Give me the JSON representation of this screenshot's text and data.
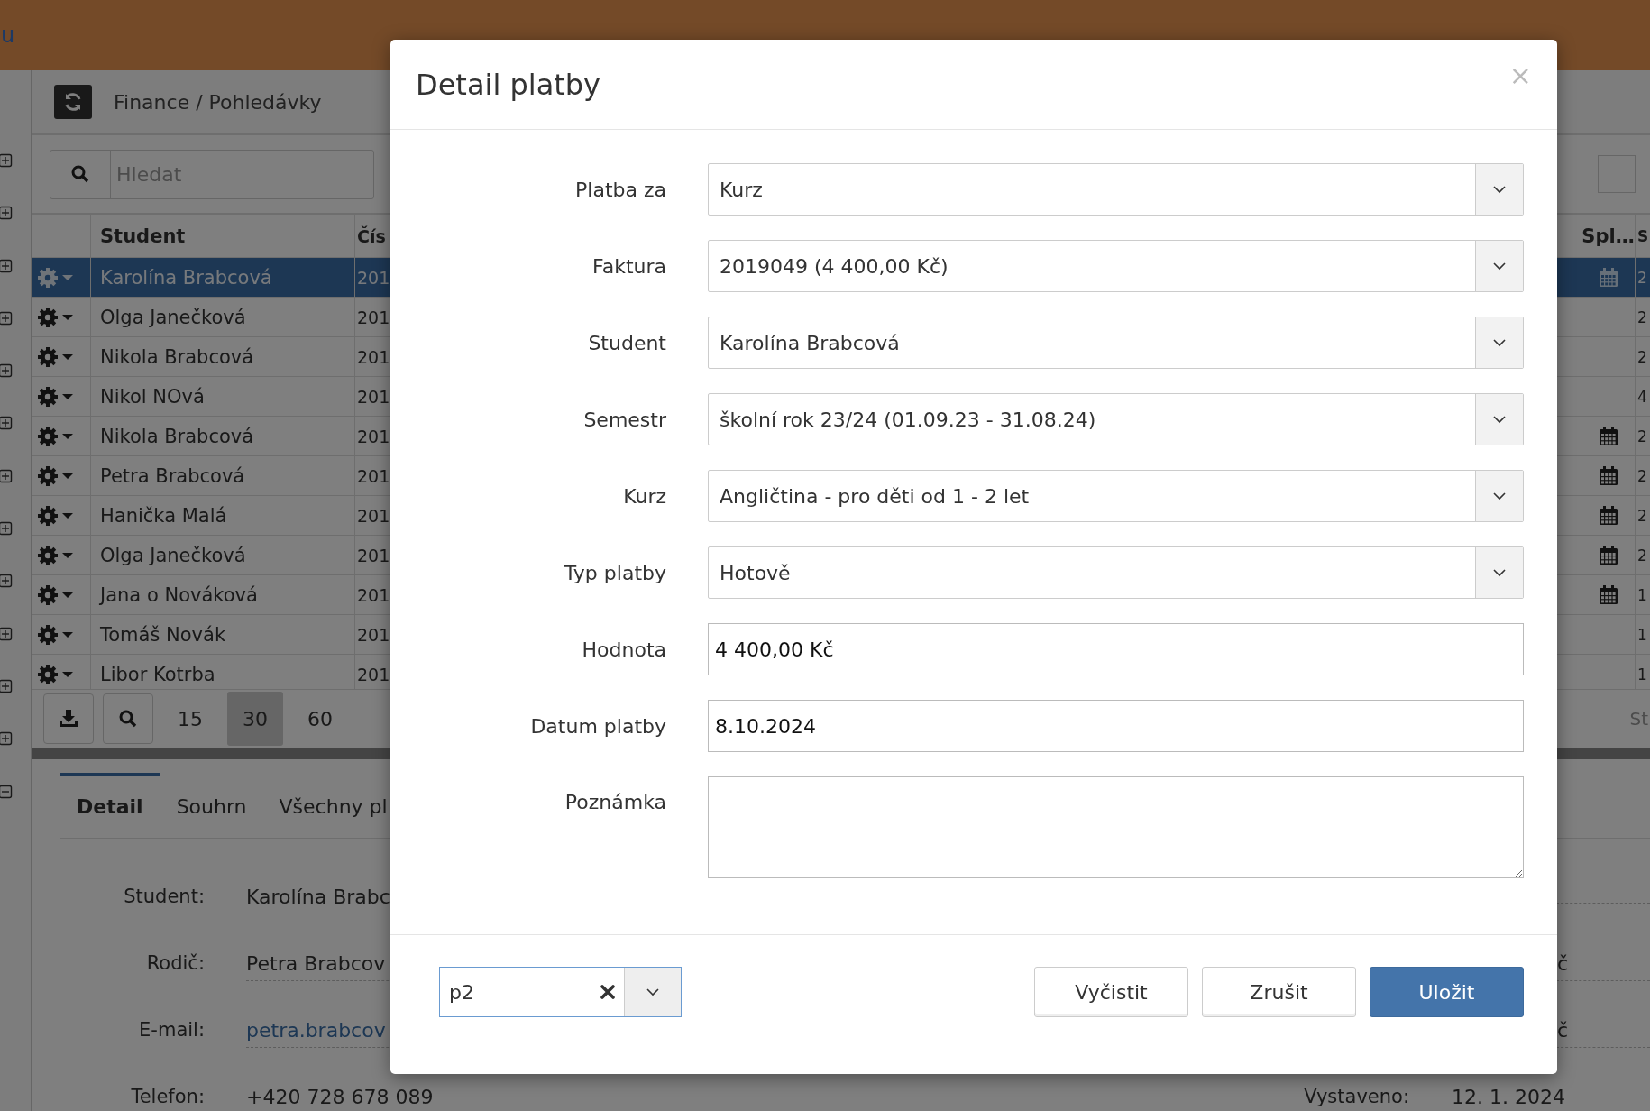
{
  "app_header": {
    "title_fragment": "u"
  },
  "sidebar": {
    "items": [
      {
        "expanded": false
      },
      {
        "expanded": false
      },
      {
        "expanded": false
      },
      {
        "expanded": false
      },
      {
        "expanded": false
      },
      {
        "expanded": false
      },
      {
        "expanded": false
      },
      {
        "expanded": false
      },
      {
        "expanded": false
      },
      {
        "expanded": false
      },
      {
        "expanded": false
      },
      {
        "expanded": false
      },
      {
        "expanded": true
      }
    ]
  },
  "breadcrumb": "Finance / Pohledávky",
  "search": {
    "placeholder": "Hledat"
  },
  "table": {
    "columns": [
      "Student",
      "Čís",
      "Spl…",
      "S"
    ],
    "rows": [
      {
        "selected": true,
        "student": "Karolína Brabcová",
        "number": "201",
        "calendar": true,
        "column_4": "2"
      },
      {
        "selected": false,
        "student": "Olga Janečková",
        "number": "201",
        "calendar": false,
        "column_4": "2"
      },
      {
        "selected": false,
        "student": "Nikola Brabcová",
        "number": "201",
        "calendar": false,
        "column_4": "2"
      },
      {
        "selected": false,
        "student": "Nikol NOvá",
        "number": "201",
        "calendar": false,
        "column_4": "4"
      },
      {
        "selected": false,
        "student": "Nikola Brabcová",
        "number": "201",
        "calendar": true,
        "column_4": "2"
      },
      {
        "selected": false,
        "student": "Petra Brabcová",
        "number": "201",
        "calendar": true,
        "column_4": "2"
      },
      {
        "selected": false,
        "student": "Hanička Malá",
        "number": "201",
        "calendar": true,
        "column_4": "2"
      },
      {
        "selected": false,
        "student": "Olga Janečková",
        "number": "201",
        "calendar": true,
        "column_4": "2"
      },
      {
        "selected": false,
        "student": "Jana o Nováková",
        "number": "201",
        "calendar": true,
        "column_4": "1"
      },
      {
        "selected": false,
        "student": "Tomáš Novák",
        "number": "201",
        "calendar": false,
        "column_4": "1"
      },
      {
        "selected": false,
        "student": "Libor Kotrba",
        "number": "201",
        "calendar": false,
        "column_4": "1"
      }
    ]
  },
  "pagination": {
    "page_sizes": [
      {
        "label": "15",
        "selected": false
      },
      {
        "label": "30",
        "selected": true
      },
      {
        "label": "60",
        "selected": false
      }
    ],
    "footer_fragment": "St"
  },
  "detail_tabs": [
    {
      "label": "Detail",
      "selected": true
    },
    {
      "label": "Souhrn",
      "selected": false
    },
    {
      "label": "Všechny pl",
      "selected": false
    }
  ],
  "detail_rows": [
    {
      "label": "Student:",
      "value": "Karolína Brabc",
      "kind": "text"
    },
    {
      "label": "Rodič:",
      "value": "Petra Brabcov",
      "kind": "text",
      "right_value": "č"
    },
    {
      "label": "E-mail:",
      "value": "petra.brabcov",
      "kind": "link",
      "right_value": "č"
    },
    {
      "label": "Telefon:",
      "value": "+420 728 678 089",
      "kind": "text",
      "right_label": "Vystaveno:",
      "right_value": "12. 1. 2024"
    }
  ],
  "modal": {
    "title": "Detail platby",
    "close": "×",
    "fields": [
      {
        "label": "Platba za",
        "kind": "select",
        "value": "Kurz"
      },
      {
        "label": "Faktura",
        "kind": "select",
        "value": "2019049 (4 400,00 Kč)"
      },
      {
        "label": "Student",
        "kind": "select",
        "value": "Karolína Brabcová"
      },
      {
        "label": "Semestr",
        "kind": "select",
        "value": "školní rok 23/24 (01.09.23 - 31.08.24)"
      },
      {
        "label": "Kurz",
        "kind": "select",
        "value": "Angličtina - pro děti od 1 - 2 let"
      },
      {
        "label": "Typ platby",
        "kind": "select",
        "value": "Hotově"
      },
      {
        "label": "Hodnota",
        "kind": "input",
        "value": "4 400,00 Kč"
      },
      {
        "label": "Datum platby",
        "kind": "input",
        "value": "8.10.2024"
      },
      {
        "label": "Poznámka",
        "kind": "textarea"
      }
    ],
    "footer_select": {
      "value": "p2"
    },
    "buttons": [
      {
        "label": "Vyčistit",
        "kind": "default"
      },
      {
        "label": "Zrušit",
        "kind": "default"
      },
      {
        "label": "Uložit",
        "kind": "primary"
      }
    ]
  }
}
